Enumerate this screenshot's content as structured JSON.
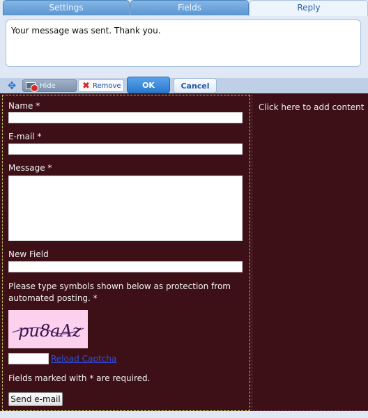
{
  "tabs": [
    {
      "label": "Settings"
    },
    {
      "label": "Fields"
    },
    {
      "label": "Reply"
    }
  ],
  "reply_message": "Your message was sent. Thank you.",
  "toolbar": {
    "move_icon": "move-arrows-icon",
    "hide_panel_label": "Hide Panel",
    "remove_label": "Remove",
    "ok_label": "OK",
    "cancel_label": "Cancel"
  },
  "form": {
    "name_label": "Name *",
    "email_label": "E-mail *",
    "message_label": "Message *",
    "new_field_label": "New Field",
    "captcha_prompt_line1": "Please type symbols shown below as protection from",
    "captcha_prompt_line2": "automated posting. *",
    "captcha_text": "pu8aAz",
    "reload_captcha_label": "Reload Captcha",
    "required_note": "Fields marked with * are required.",
    "send_label": "Send e-mail"
  },
  "right_panel": {
    "placeholder": "Click here to add content"
  },
  "colors": {
    "form_background": "#3d1018",
    "captcha_background": "#fbd1ee",
    "link": "#2f4fe0",
    "tab_active_text": "#2c62a6"
  }
}
